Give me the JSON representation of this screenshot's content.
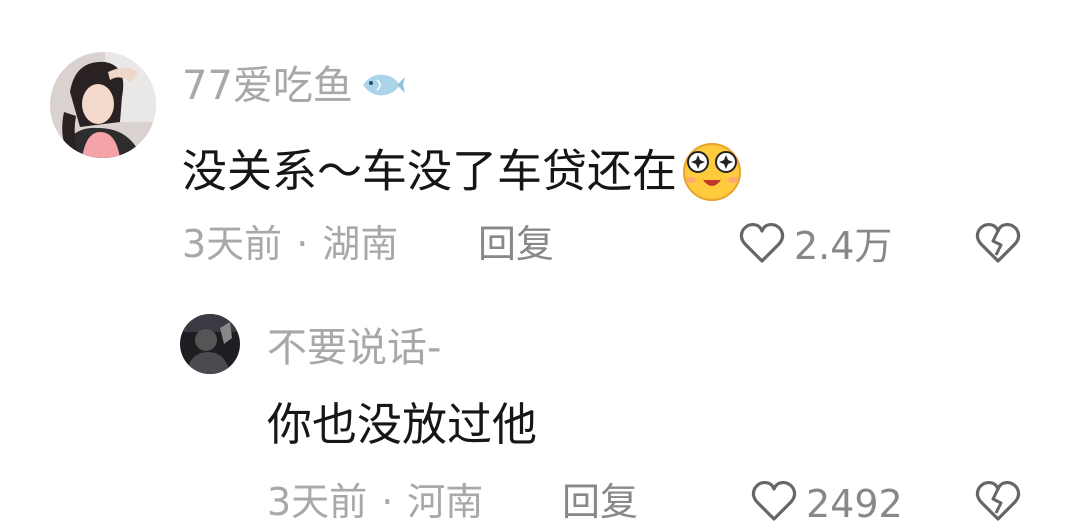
{
  "comments": [
    {
      "username": "77爱吃鱼",
      "username_badge_icon": "fish-icon",
      "text": "没关系～车没了车贷还在",
      "emoji_icon": "starry-eyes-emoji",
      "time": "3天前",
      "separator": "·",
      "location": "湖南",
      "reply_label": "回复",
      "like_count": "2.4万"
    },
    {
      "username": "不要说话-",
      "text": "你也没放过他",
      "time": "3天前",
      "separator": "·",
      "location": "河南",
      "reply_label": "回复",
      "like_count": "2492"
    }
  ],
  "colors": {
    "text_primary": "#161616",
    "text_secondary": "#a8a8a8",
    "action_gray": "#888888",
    "background": "#ffffff"
  }
}
